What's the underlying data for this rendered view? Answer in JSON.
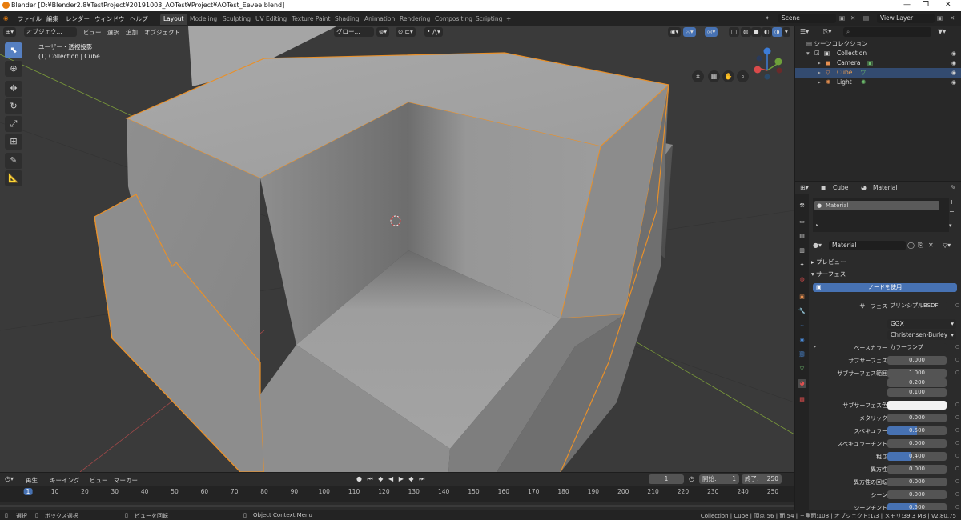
{
  "window": {
    "title": "Blender [D:¥Blender2.8¥TestProject¥20191003_AOTest¥Project¥AOTest_Eevee.blend]",
    "minimize": "—",
    "maximize": "❐",
    "close": "✕"
  },
  "menubar": {
    "items": [
      "ファイル",
      "編集",
      "レンダー",
      "ウィンドウ",
      "ヘルプ"
    ],
    "tabs": [
      "Layout",
      "Modeling",
      "Sculpting",
      "UV Editing",
      "Texture Paint",
      "Shading",
      "Animation",
      "Rendering",
      "Compositing",
      "Scripting"
    ],
    "add_tab": "+",
    "scene": "Scene",
    "view_layer": "View Layer"
  },
  "viewport": {
    "mode": "オブジェク...",
    "menus": [
      "ビュー",
      "選択",
      "追加",
      "オブジェクト"
    ],
    "transform_orientation": "グロー...",
    "view_name": "ユーザー・透視投影",
    "collection_info": "(1) Collection | Cube"
  },
  "outliner": {
    "search_placeholder": "",
    "root": "シーンコレクション",
    "collection": "Collection",
    "items": [
      "Camera",
      "Cube",
      "Light"
    ]
  },
  "properties": {
    "object": "Cube",
    "material_tab": "Material",
    "slot": "Material",
    "material_name": "Material",
    "preview": "プレビュー",
    "surface_section": "サーフェス",
    "use_nodes": "ノードを使用",
    "surface_label": "サーフェス",
    "surface_value": "プリンシプルBSDF",
    "distribution": "GGX",
    "subsurface_method": "Christensen-Burley",
    "rows": [
      {
        "label": "ベースカラー",
        "value": "カラーランプ",
        "fill": 0
      },
      {
        "label": "サブサーフェス",
        "value": "0.000",
        "fill": 0
      },
      {
        "label": "サブサーフェス範囲",
        "value": "1.000",
        "fill": 0
      },
      {
        "label": "",
        "value": "0.200",
        "fill": 0
      },
      {
        "label": "",
        "value": "0.100",
        "fill": 0
      },
      {
        "label": "サブサーフェス色",
        "value": "",
        "fill": 0
      },
      {
        "label": "メタリック",
        "value": "0.000",
        "fill": 0
      },
      {
        "label": "スペキュラー",
        "value": "0.500",
        "fill": 0.5
      },
      {
        "label": "スペキュラーチント",
        "value": "0.000",
        "fill": 0
      },
      {
        "label": "粗さ",
        "value": "0.400",
        "fill": 0.4
      },
      {
        "label": "異方性",
        "value": "0.000",
        "fill": 0
      },
      {
        "label": "異方性の回転",
        "value": "0.000",
        "fill": 0
      },
      {
        "label": "シーン",
        "value": "0.000",
        "fill": 0
      },
      {
        "label": "シーンチント",
        "value": "0.500",
        "fill": 0.5
      }
    ]
  },
  "timeline": {
    "menus": [
      "再生",
      "キーイング",
      "ビュー",
      "マーカー"
    ],
    "current_frame": "1",
    "start_label": "開始:",
    "start": "1",
    "end_label": "終了:",
    "end": "250",
    "ticks": [
      "1",
      "10",
      "20",
      "30",
      "40",
      "50",
      "60",
      "70",
      "80",
      "90",
      "100",
      "110",
      "120",
      "130",
      "140",
      "150",
      "160",
      "170",
      "180",
      "190",
      "200",
      "210",
      "220",
      "230",
      "240",
      "250"
    ]
  },
  "statusbar": {
    "select": "選択",
    "box_select": "ボックス選択",
    "rotate_view": "ビューを回転",
    "context_menu": "Object Context Menu",
    "stats": "Collection | Cube | 頂点:56 | 面:54 | 三角面:108 | オブジェクト:1/3 | メモリ:39.3 MB | v2.80.75"
  }
}
